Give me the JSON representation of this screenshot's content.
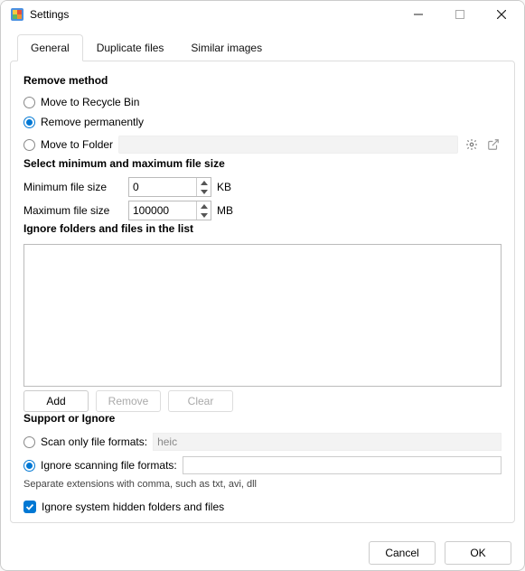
{
  "window": {
    "title": "Settings"
  },
  "tabs": [
    "General",
    "Duplicate files",
    "Similar images"
  ],
  "remove_method": {
    "heading": "Remove method",
    "options": {
      "recycle": "Move to Recycle Bin",
      "permanent": "Remove permanently",
      "folder": "Move to Folder"
    }
  },
  "file_size": {
    "heading": "Select minimum and maximum file size",
    "min_label": "Minimum file size",
    "max_label": "Maximum file size",
    "min_value": "0",
    "max_value": "100000",
    "min_unit": "KB",
    "max_unit": "MB"
  },
  "ignore_list": {
    "heading": "Ignore folders and files in the list",
    "buttons": {
      "add": "Add",
      "remove": "Remove",
      "clear": "Clear"
    }
  },
  "support_ignore": {
    "heading": "Support or Ignore",
    "scan_only_label": "Scan only file formats:",
    "scan_only_value": "heic",
    "ignore_label": "Ignore scanning file formats:",
    "ignore_value": "",
    "hint": "Separate extensions with comma, such as txt, avi, dll",
    "hidden_label": "Ignore system hidden folders and files"
  },
  "footer": {
    "cancel": "Cancel",
    "ok": "OK"
  },
  "colors": {
    "accent": "#0078d4"
  }
}
